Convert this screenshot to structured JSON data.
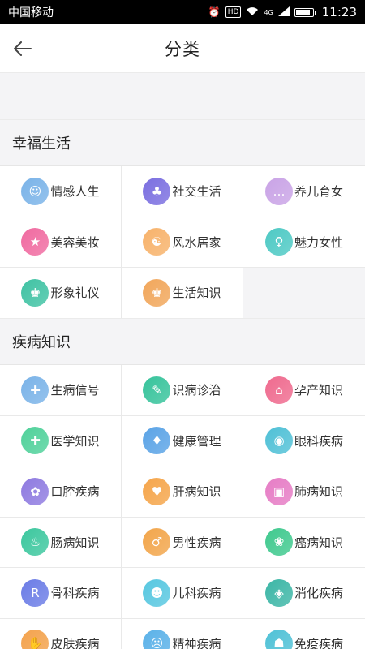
{
  "status": {
    "carrier": "中国移动",
    "time": "11:23",
    "hd": "HD",
    "signal": "4G"
  },
  "header": {
    "title": "分类"
  },
  "sections": [
    {
      "title": "幸福生活",
      "items": [
        {
          "label": "情感人生",
          "icon": "couple-icon",
          "color": "#7ab3e8",
          "glyph": "☺"
        },
        {
          "label": "社交生活",
          "icon": "crowd-icon",
          "color": "#7a6ee0",
          "glyph": "♣"
        },
        {
          "label": "养儿育女",
          "icon": "chat-bubble-icon",
          "color": "#c9a3e6",
          "glyph": "…"
        },
        {
          "label": "美容美妆",
          "icon": "star-wand-icon",
          "color": "#f06aa0",
          "glyph": "★"
        },
        {
          "label": "风水居家",
          "icon": "feng-shui-icon",
          "color": "#f7b26a",
          "glyph": "☯"
        },
        {
          "label": "魅力女性",
          "icon": "woman-icon",
          "color": "#4dc9c4",
          "glyph": "♀"
        },
        {
          "label": "形象礼仪",
          "icon": "person-icon",
          "color": "#3fc2a3",
          "glyph": "♚"
        },
        {
          "label": "生活知识",
          "icon": "person-icon",
          "color": "#f1a65a",
          "glyph": "♚"
        }
      ]
    },
    {
      "title": "疾病知识",
      "items": [
        {
          "label": "生病信号",
          "icon": "sick-person-icon",
          "color": "#7ab3e8",
          "glyph": "✚"
        },
        {
          "label": "识病诊治",
          "icon": "doctor-icon",
          "color": "#36c39b",
          "glyph": "✎"
        },
        {
          "label": "孕产知识",
          "icon": "house-icon",
          "color": "#ef6a8e",
          "glyph": "⌂"
        },
        {
          "label": "医学知识",
          "icon": "medicine-icon",
          "color": "#4fd19a",
          "glyph": "✚"
        },
        {
          "label": "健康管理",
          "icon": "doctor-person-icon",
          "color": "#5aa3e6",
          "glyph": "♦"
        },
        {
          "label": "眼科疾病",
          "icon": "eye-mask-icon",
          "color": "#4fc0d6",
          "glyph": "◉"
        },
        {
          "label": "口腔疾病",
          "icon": "tooth-icon",
          "color": "#8e7ae0",
          "glyph": "✿"
        },
        {
          "label": "肝病知识",
          "icon": "liver-icon",
          "color": "#f5a54a",
          "glyph": "♥"
        },
        {
          "label": "肺病知识",
          "icon": "lung-icon",
          "color": "#e67cc5",
          "glyph": "▣"
        },
        {
          "label": "肠病知识",
          "icon": "intestine-icon",
          "color": "#3cc79e",
          "glyph": "♨"
        },
        {
          "label": "男性疾病",
          "icon": "man-icon",
          "color": "#f2a54a",
          "glyph": "♂"
        },
        {
          "label": "癌病知识",
          "icon": "plant-icon",
          "color": "#3fc98e",
          "glyph": "❀"
        },
        {
          "label": "骨科疾病",
          "icon": "bone-icon",
          "color": "#6b7ce6",
          "glyph": "R"
        },
        {
          "label": "儿科疾病",
          "icon": "child-icon",
          "color": "#57c7e0",
          "glyph": "☻"
        },
        {
          "label": "消化疾病",
          "icon": "stomach-icon",
          "color": "#3cb6a6",
          "glyph": "◈"
        },
        {
          "label": "皮肤疾病",
          "icon": "skin-icon",
          "color": "#f3a24c",
          "glyph": "✋"
        },
        {
          "label": "精神疾病",
          "icon": "brain-icon",
          "color": "#5ab1e8",
          "glyph": "☹"
        },
        {
          "label": "免疫疾病",
          "icon": "shield-person-icon",
          "color": "#4fc1d6",
          "glyph": "☗"
        }
      ]
    }
  ]
}
